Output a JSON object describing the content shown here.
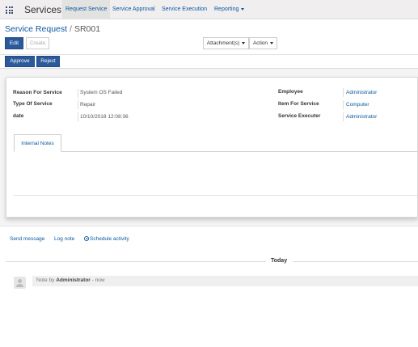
{
  "navbar": {
    "brand": "Services",
    "items": [
      {
        "label": "Request Service"
      },
      {
        "label": "Service Approval"
      },
      {
        "label": "Service Execution"
      },
      {
        "label": "Reporting"
      }
    ]
  },
  "control_panel": {
    "breadcrumb_parent": "Service Request",
    "breadcrumb_separator": "/",
    "breadcrumb_current": "SR001",
    "edit_label": "Edit",
    "create_label": "Create",
    "attachments_label": "Attachment(s)",
    "action_label": "Action"
  },
  "statusbar": {
    "approve_label": "Approve",
    "reject_label": "Reject"
  },
  "form": {
    "left": [
      {
        "label": "Reason For Service",
        "value": "System OS Failed"
      },
      {
        "label": "Type Of Service",
        "value": "Repair"
      },
      {
        "label": "date",
        "value": "10/10/2018 12:08:36"
      }
    ],
    "right": [
      {
        "label": "Employee",
        "value": "Administrator"
      },
      {
        "label": "Item For Service",
        "value": "Computer"
      },
      {
        "label": "Service Executer",
        "value": "Administrator"
      }
    ],
    "tab_label": "Internal Notes"
  },
  "chatter": {
    "send_message": "Send message",
    "log_note": "Log note",
    "schedule_activity": "Schedule activity",
    "today": "Today",
    "message": {
      "prefix": "Note by",
      "author": "Administrator",
      "time": "- now"
    }
  },
  "colors": {
    "primary": "#2a5a9a",
    "link": "#0d5aa0"
  },
  "icons": [
    "apps-grid-icon",
    "caret-down-icon",
    "clock-icon",
    "avatar-icon"
  ]
}
